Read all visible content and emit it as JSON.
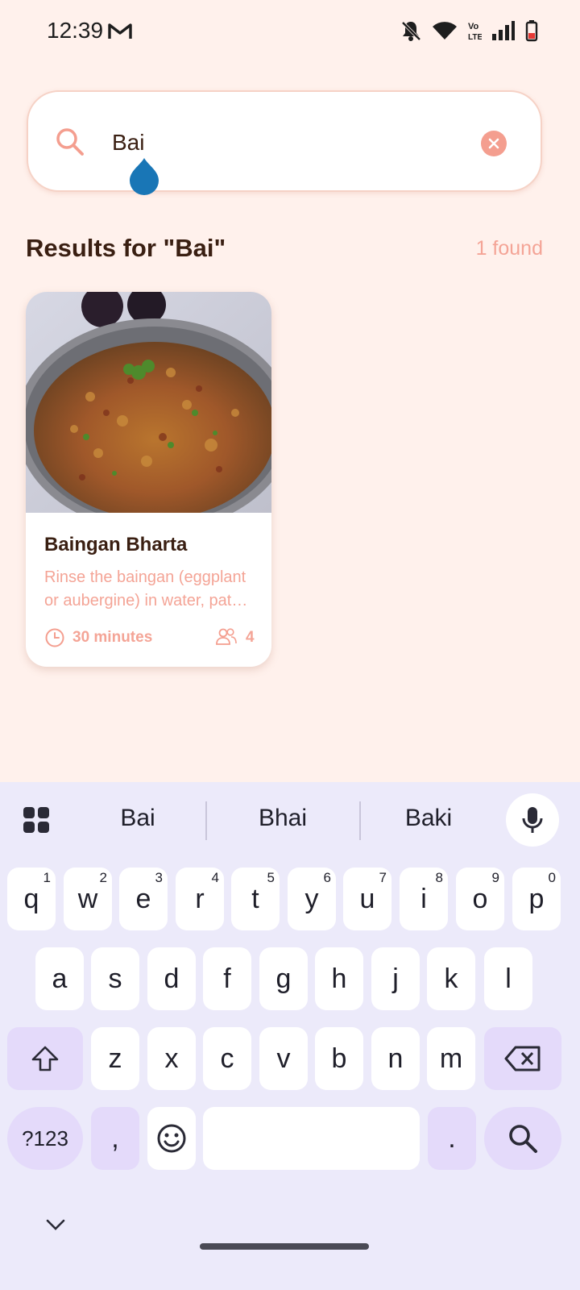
{
  "status_bar": {
    "time": "12:39"
  },
  "search": {
    "query": "Bai",
    "placeholder": ""
  },
  "results": {
    "title": "Results for \"Bai\"",
    "count": "1 found"
  },
  "recipes": [
    {
      "title": "Baingan Bharta",
      "description": "Rinse the baingan (eggplant or aubergine) in water, pat dry and prick all over with a fork.",
      "time": "30 minutes",
      "servings": "4"
    }
  ],
  "keyboard": {
    "suggestions": [
      "Bai",
      "Bhai",
      "Baki"
    ],
    "row1": [
      "q",
      "w",
      "e",
      "r",
      "t",
      "y",
      "u",
      "i",
      "o",
      "p"
    ],
    "row1_hints": [
      "1",
      "2",
      "3",
      "4",
      "5",
      "6",
      "7",
      "8",
      "9",
      "0"
    ],
    "row2": [
      "a",
      "s",
      "d",
      "f",
      "g",
      "h",
      "j",
      "k",
      "l"
    ],
    "row3": [
      "z",
      "x",
      "c",
      "v",
      "b",
      "n",
      "m"
    ],
    "symbols_label": "?123",
    "comma": ",",
    "period": "."
  },
  "colors": {
    "accent": "#F49E8F",
    "background": "#FFF1EC",
    "keyboard_bg": "#ECEAFA"
  }
}
